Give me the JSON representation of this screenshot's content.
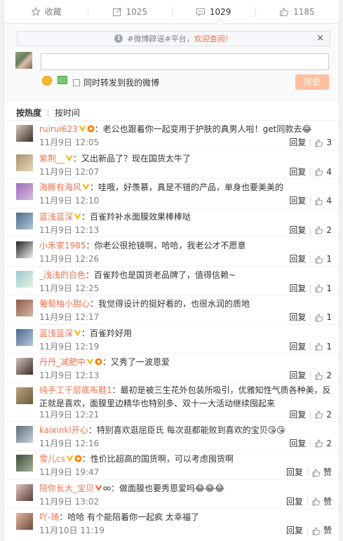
{
  "actions": [
    {
      "label": "收藏",
      "icon": "star-icon"
    },
    {
      "label": "1025",
      "icon": "forward-icon"
    },
    {
      "label": "1029",
      "icon": "comment-icon"
    },
    {
      "label": "1185",
      "icon": "like-icon"
    }
  ],
  "notice": {
    "text": "#微博辟谣#平台，",
    "link": "欢迎查阅！",
    "close": "×"
  },
  "composer": {
    "placeholder": "",
    "forward_label": "同时转发到我的微博",
    "submit_label": "评论"
  },
  "sort": {
    "hot": "按热度",
    "time": "按时间"
  },
  "colors": {
    "accent": "#eb7350",
    "vip": "#f7b500",
    "submit_bg": "#ffc09f"
  },
  "comments": [
    {
      "name": "ruirui623",
      "badges": [
        "vip",
        "level"
      ],
      "text": "：老公也跟着你一起变用于护肤的真男人啦！get同款去😂",
      "time": "11月9日 12:05",
      "reply": "回复",
      "likes": "3",
      "avatar": [
        "#d6c7b6",
        "#3c2f2a"
      ]
    },
    {
      "name": "紫荆__",
      "badges": [
        "vip"
      ],
      "text": "：又出新品了？现在国货太牛了",
      "time": "11月9日 12:07",
      "reply": "回复",
      "likes": "4",
      "avatar": [
        "#a98f6f",
        "#e9d8b5"
      ]
    },
    {
      "name": "海豚有海风",
      "badges": [
        "vip"
      ],
      "text": "：哇哦，好羡慕，真是不错的产品，单身也要美美的",
      "time": "11月9日 12:10",
      "reply": "回复",
      "likes": "4",
      "avatar": [
        "#9d6fb8",
        "#d7b8e1"
      ]
    },
    {
      "name": "蓝浅蓝深",
      "badges": [
        "vip"
      ],
      "text": "：百雀羚补水面膜效果棒棒哒",
      "time": "11月9日 12:13",
      "reply": "回复",
      "likes": "2",
      "avatar": [
        "#4a6a8c",
        "#b7c7d9"
      ]
    },
    {
      "name": "小禾家1985",
      "badges": [],
      "text": "：你老公很抢镜啊，哈哈，我老公才不愿意",
      "time": "11月9日 12:26",
      "reply": "回复",
      "likes": "1",
      "avatar": [
        "#222222",
        "#f2f2f2"
      ]
    },
    {
      "name": "_浅浅的白色",
      "badges": [],
      "text": "：百雀羚也是国货老品牌了，值得信赖~",
      "time": "11月9日 12:25",
      "reply": "回复",
      "likes": "1",
      "avatar": [
        "#9cc9cf",
        "#e6f1e3"
      ]
    },
    {
      "name": "葡萄柚小甜心",
      "badges": [],
      "text": "：我觉得设计的挺好看的，也很水润的质地",
      "time": "11月9日 12:17",
      "reply": "回复",
      "likes": "1",
      "avatar": [
        "#8a5a4a",
        "#d9b7a6"
      ]
    },
    {
      "name": "蓝浅蓝深",
      "badges": [
        "vip"
      ],
      "text": "：百雀羚好用",
      "time": "11月9日 12:19",
      "reply": "回复",
      "likes": "1",
      "avatar": [
        "#4a6a8c",
        "#b7c7d9"
      ]
    },
    {
      "name": "丹丹_减肥中",
      "badges": [
        "vip",
        "level"
      ],
      "text": "：又秀了一波恩爱",
      "time": "11月9日 12:13",
      "reply": "回复",
      "likes": "2",
      "avatar": [
        "#cfc2bd",
        "#3b2b28"
      ]
    },
    {
      "name": "纯手工千层底布鞋1",
      "badges": [],
      "text": "：最初是被三生花外包装所吸引，优雅知性气质各种美，反正就是喜欢，面膜里边精华也特别多、双十一大活动继续囤起来",
      "time": "11月9日 12:21",
      "reply": "回复",
      "likes": "2",
      "avatar": [
        "#b9a27d",
        "#6b5a3d"
      ],
      "tall": true
    },
    {
      "name": "kaixinkl开心",
      "badges": [],
      "text": "：特别喜欢逛屈臣氏 每次逛都能败到喜欢的宝贝😘😘",
      "time": "11月9日 12:16",
      "reply": "回复",
      "likes": "2",
      "avatar": [
        "#5f6b7b",
        "#c9d2dc"
      ]
    },
    {
      "name": "雪儿cs",
      "badges": [
        "vip",
        "level"
      ],
      "text": "：性价比超高的国货啊，可以考虑囤货啊",
      "time": "11月9日 19:47",
      "reply": "回复",
      "likes": "赞",
      "avatar": [
        "#3f4a3a",
        "#a8b59a"
      ]
    },
    {
      "name": "陪你长大_宝贝",
      "badges": [
        "vip2",
        "glasses"
      ],
      "text": "：做面膜也要秀恩爱吗😂😂😂",
      "time": "11月9日 13:02",
      "reply": "回复",
      "likes": "赞",
      "avatar": [
        "#e0c7c2",
        "#5a3a34"
      ]
    },
    {
      "name": "吖-琦",
      "badges": [],
      "text": "：哈哈 有个能陪着你一起疯 太幸福了",
      "time": "11月10日 11:19",
      "reply": "回复",
      "likes": "赞",
      "avatar": [
        "#e5b7a3",
        "#6e4a3a"
      ]
    }
  ]
}
